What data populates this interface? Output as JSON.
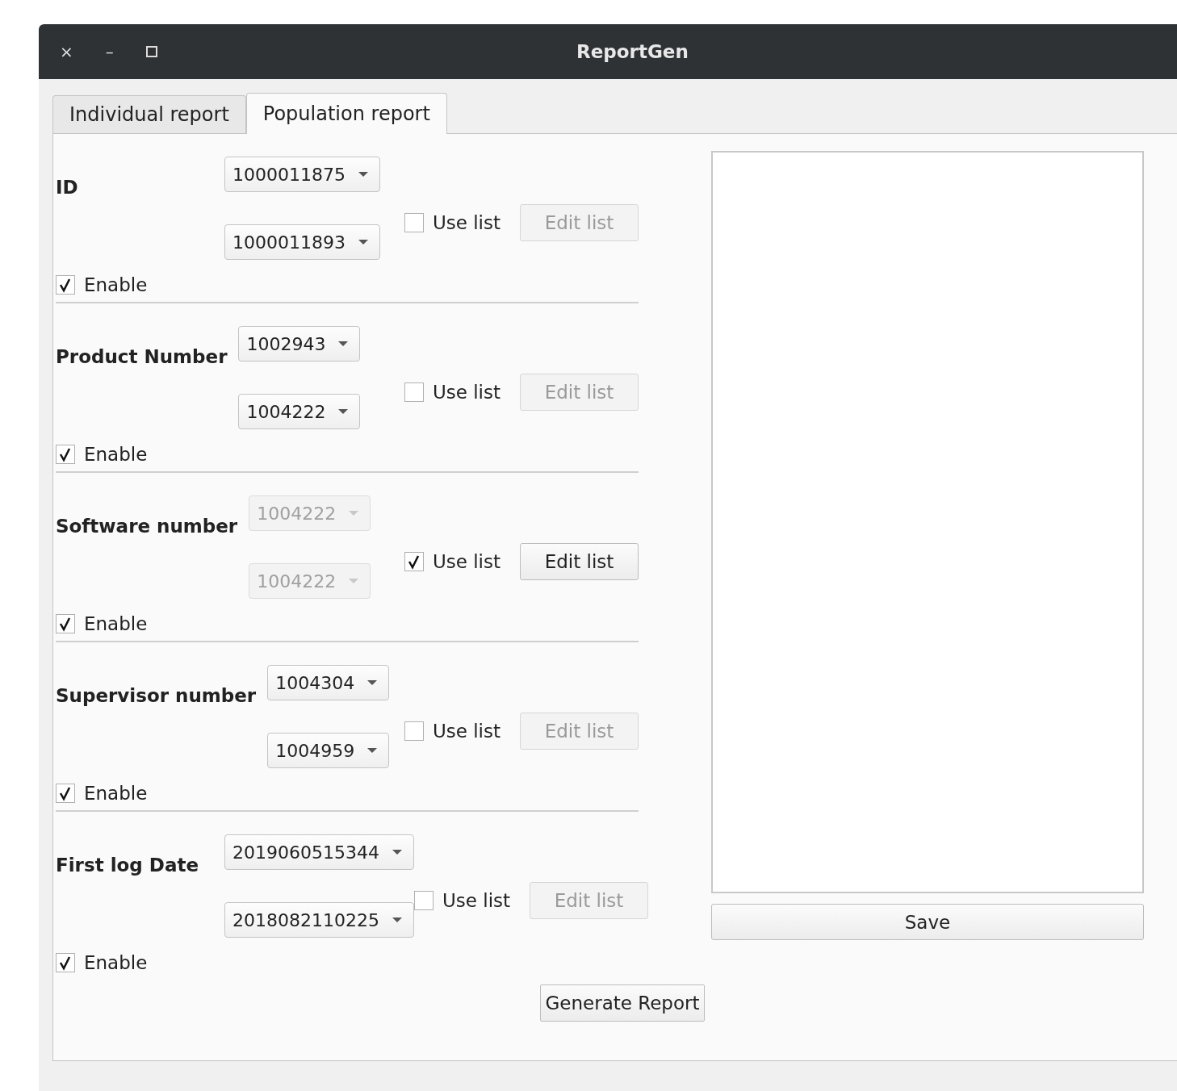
{
  "window": {
    "title": "ReportGen",
    "controls": [
      "×",
      "–"
    ]
  },
  "tabs": [
    {
      "label": "Individual report",
      "selected": false
    },
    {
      "label": "Population report",
      "selected": true
    }
  ],
  "sections": [
    {
      "label": "ID",
      "combos": [
        {
          "value": "1000011875",
          "disabled": false
        },
        {
          "value": "1000011893",
          "disabled": false
        }
      ],
      "use_list": {
        "label": "Use list",
        "checked": false
      },
      "edit_button": {
        "label": "Edit list",
        "disabled": true
      },
      "enable": {
        "label": "Enable",
        "checked": true
      }
    },
    {
      "label": "Product Number",
      "combos": [
        {
          "value": "1002943",
          "disabled": false
        },
        {
          "value": "1004222",
          "disabled": false
        }
      ],
      "use_list": {
        "label": "Use list",
        "checked": false
      },
      "edit_button": {
        "label": "Edit list",
        "disabled": true
      },
      "enable": {
        "label": "Enable",
        "checked": true
      }
    },
    {
      "label": "Software number",
      "combos": [
        {
          "value": "1004222",
          "disabled": true
        },
        {
          "value": "1004222",
          "disabled": true
        }
      ],
      "use_list": {
        "label": "Use list",
        "checked": true
      },
      "edit_button": {
        "label": "Edit list",
        "disabled": false
      },
      "enable": {
        "label": "Enable",
        "checked": true
      }
    },
    {
      "label": "Supervisor number",
      "combos": [
        {
          "value": "1004304",
          "disabled": false
        },
        {
          "value": "1004959",
          "disabled": false
        }
      ],
      "use_list": {
        "label": "Use list",
        "checked": false
      },
      "edit_button": {
        "label": "Edit list",
        "disabled": true
      },
      "enable": {
        "label": "Enable",
        "checked": true
      }
    },
    {
      "label": "First log Date",
      "combos": [
        {
          "value": "2019060515344",
          "disabled": false
        },
        {
          "value": "2018082110225",
          "disabled": false
        }
      ],
      "use_list": {
        "label": "Use list",
        "checked": false
      },
      "edit_button": {
        "label": "Edit list",
        "disabled": true
      },
      "enable": {
        "label": "Enable",
        "checked": true
      }
    }
  ],
  "save_button": "Save",
  "generate_button": "Generate Report"
}
